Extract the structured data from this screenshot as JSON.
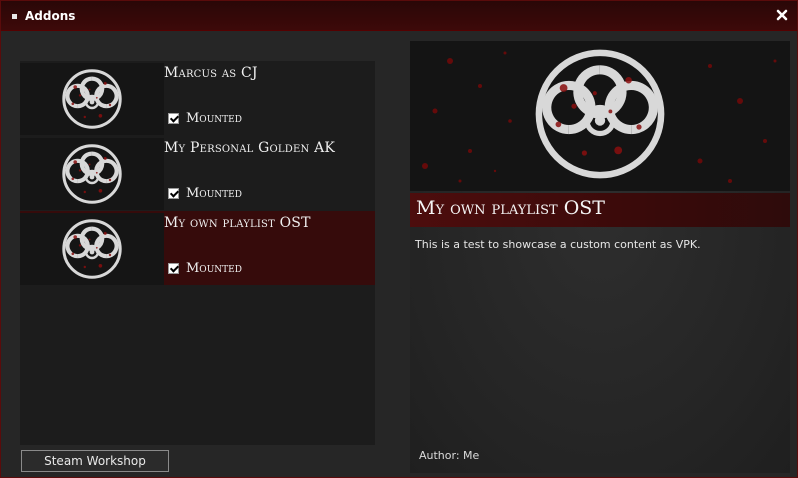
{
  "window": {
    "title": "Addons",
    "close_icon": "close-icon"
  },
  "addons": [
    {
      "name": "Marcus as CJ",
      "mounted_label": "Mounted",
      "mounted": true,
      "icon": "biohazard-icon"
    },
    {
      "name": "My Personal Golden AK",
      "mounted_label": "Mounted",
      "mounted": true,
      "icon": "biohazard-icon"
    },
    {
      "name": "My own playlist OST",
      "mounted_label": "Mounted",
      "mounted": true,
      "icon": "biohazard-icon",
      "selected": true
    }
  ],
  "steam_workshop_label": "Steam Workshop",
  "detail": {
    "title": "My own playlist OST",
    "description": "This is a test to showcase a custom content as VPK.",
    "author_label": "Author:",
    "author": "Me",
    "banner_icon": "biohazard-icon"
  },
  "colors": {
    "accent": "#4d0d0d",
    "selected_row": "#360b0b",
    "panel": "#1c1c1c"
  }
}
